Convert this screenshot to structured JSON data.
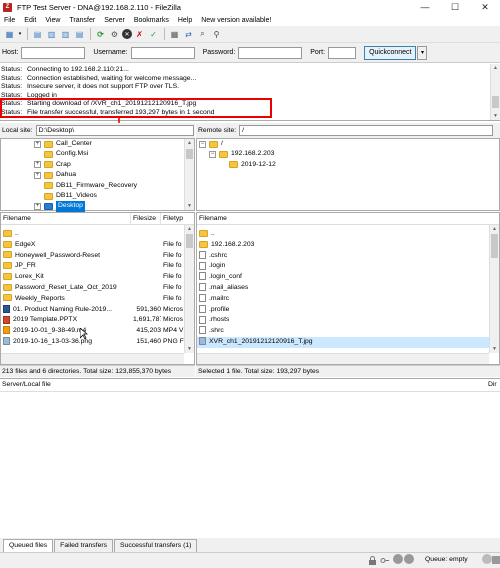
{
  "window": {
    "title": "FTP Test Server - DNA@192.168.2.110 - FileZilla",
    "minimize": "—",
    "maximize": "☐",
    "close": "✕"
  },
  "menu": [
    "File",
    "Edit",
    "View",
    "Transfer",
    "Server",
    "Bookmarks",
    "Help",
    "New version available!"
  ],
  "quickconnect": {
    "host_label": "Host:",
    "user_label": "Username:",
    "pass_label": "Password:",
    "port_label": "Port:",
    "button": "Quickconnect",
    "host_value": "",
    "user_value": "",
    "pass_value": "",
    "port_value": ""
  },
  "log": [
    {
      "k": "Status:",
      "v": "Connecting to 192.168.2.110:21..."
    },
    {
      "k": "Status:",
      "v": "Connection established, waiting for welcome message..."
    },
    {
      "k": "Status:",
      "v": "Insecure server, it does not support FTP over TLS."
    },
    {
      "k": "Status:",
      "v": "Logged in"
    },
    {
      "k": "Status:",
      "v": "Starting download of /XVR_ch1_20191212120916_T.jpg"
    },
    {
      "k": "Status:",
      "v": "File transfer successful, transferred 193,297 bytes in 1 second"
    }
  ],
  "local": {
    "site_label": "Local site:",
    "path": "D:\\Desktop\\",
    "tree": [
      "Call_Center",
      "Config.Msi",
      "Crap",
      "Dahua",
      "DB11_Firmware_Recovery",
      "DB11_Videos",
      "Desktop"
    ],
    "headers": [
      "Filename",
      "Filesize",
      "Filetyp"
    ],
    "files": [
      {
        "name": "..",
        "size": "",
        "type": ""
      },
      {
        "name": "EdgeX",
        "size": "",
        "type": "File fo"
      },
      {
        "name": "Honeywell_Password-Reset",
        "size": "",
        "type": "File fo"
      },
      {
        "name": "JP_FR",
        "size": "",
        "type": "File fo"
      },
      {
        "name": "Lorex_Kit",
        "size": "",
        "type": "File fo"
      },
      {
        "name": "Password_Reset_Late_Oct_2019",
        "size": "",
        "type": "File fo"
      },
      {
        "name": "Weekly_Reports",
        "size": "",
        "type": "File fo"
      },
      {
        "name": "01. Product Naming Rule-2019...",
        "size": "591,360",
        "type": "Micros"
      },
      {
        "name": "2019 Template.PPTX",
        "size": "1,691,787",
        "type": "Micros"
      },
      {
        "name": "2019-10-01_9-38-49.m4",
        "size": "415,203",
        "type": "MP4 V"
      },
      {
        "name": "2019-10-16_13-03-36.png",
        "size": "151,460",
        "type": "PNG F"
      }
    ],
    "status": "213 files and 6 directories. Total size: 123,855,370 bytes"
  },
  "remote": {
    "site_label": "Remote site:",
    "path": "/",
    "tree": [
      "/",
      "192.168.2.203",
      "2019-12-12"
    ],
    "headers": [
      "Filename"
    ],
    "files": [
      "..",
      "192.168.2.203",
      ".cshrc",
      ".login",
      ".login_conf",
      ".mail_aliases",
      ".mailrc",
      ".profile",
      ".rhosts",
      ".shrc",
      "XVR_ch1_20191212120916_T.jpg"
    ],
    "status": "Selected 1 file. Total size: 193,297 bytes"
  },
  "queue": {
    "col1": "Server/Local file",
    "col2": "Dir"
  },
  "queue_tabs": [
    "Queued files",
    "Failed transfers",
    "Successful transfers (1)"
  ],
  "bottom": {
    "queue_status": "Queue: empty"
  },
  "colors": {
    "highlight": "#cce8ff",
    "selected": "#0078d7",
    "redbox": "#e00000",
    "folder": "#f5c542"
  }
}
